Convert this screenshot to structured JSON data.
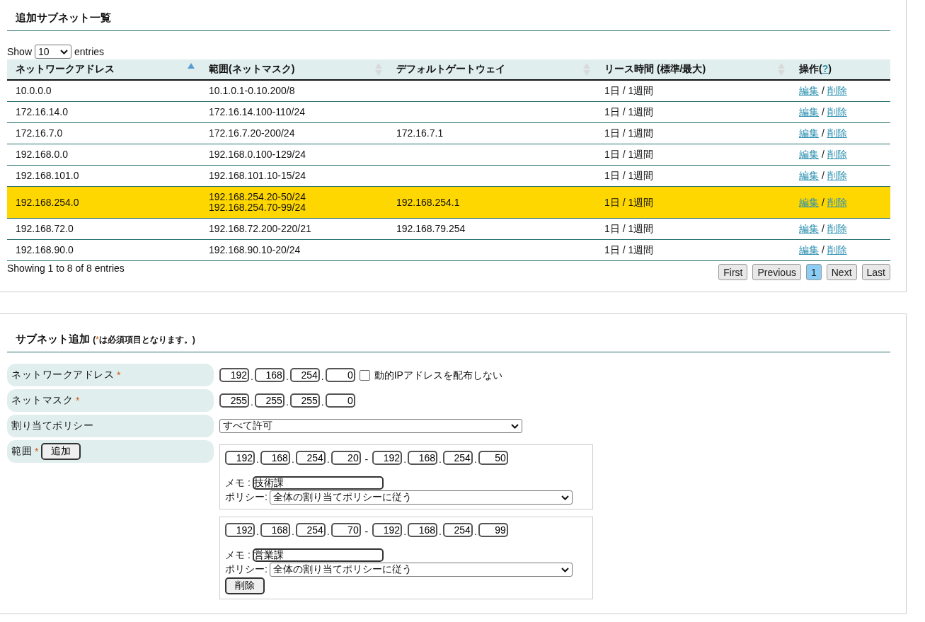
{
  "subnet_list": {
    "title": "追加サブネット一覧",
    "length": {
      "before": "Show",
      "value": "10",
      "after": "entries"
    },
    "columns": [
      {
        "label": "ネットワークアドレス",
        "sortable": true,
        "sorted": true
      },
      {
        "label": "範囲(ネットマスク)",
        "sortable": true,
        "sorted": false
      },
      {
        "label": "デフォルトゲートウェイ",
        "sortable": true,
        "sorted": false
      },
      {
        "label": "リース時間 (標準/最大)",
        "sortable": true,
        "sorted": false
      },
      {
        "label": "操作(",
        "help_link": "?",
        "after": ")",
        "sortable": false
      }
    ],
    "rows": [
      {
        "network": "10.0.0.0",
        "ranges": [
          "10.1.0.1-0.10.200/8"
        ],
        "gateway": "",
        "lease": "1日 / 1週間",
        "edit": "編集",
        "separator": "/",
        "delete": "削除",
        "selected": false
      },
      {
        "network": "172.16.14.0",
        "ranges": [
          "172.16.14.100-110/24"
        ],
        "gateway": "",
        "lease": "1日 / 1週間",
        "edit": "編集",
        "separator": "/",
        "delete": "削除",
        "selected": false
      },
      {
        "network": "172.16.7.0",
        "ranges": [
          "172.16.7.20-200/24"
        ],
        "gateway": "172.16.7.1",
        "lease": "1日 / 1週間",
        "edit": "編集",
        "separator": "/",
        "delete": "削除",
        "selected": false
      },
      {
        "network": "192.168.0.0",
        "ranges": [
          "192.168.0.100-129/24"
        ],
        "gateway": "",
        "lease": "1日 / 1週間",
        "edit": "編集",
        "separator": "/",
        "delete": "削除",
        "selected": false
      },
      {
        "network": "192.168.101.0",
        "ranges": [
          "192.168.101.10-15/24"
        ],
        "gateway": "",
        "lease": "1日 / 1週間",
        "edit": "編集",
        "separator": "/",
        "delete": "削除",
        "selected": false
      },
      {
        "network": "192.168.254.0",
        "ranges": [
          "192.168.254.20-50/24",
          "192.168.254.70-99/24"
        ],
        "gateway": "192.168.254.1",
        "lease": "1日 / 1週間",
        "edit": "編集",
        "separator": "/",
        "delete": "削除",
        "selected": true
      },
      {
        "network": "192.168.72.0",
        "ranges": [
          "192.168.72.200-220/21"
        ],
        "gateway": "192.168.79.254",
        "lease": "1日 / 1週間",
        "edit": "編集",
        "separator": "/",
        "delete": "削除",
        "selected": false
      },
      {
        "network": "192.168.90.0",
        "ranges": [
          "192.168.90.10-20/24"
        ],
        "gateway": "",
        "lease": "1日 / 1週間",
        "edit": "編集",
        "separator": "/",
        "delete": "削除",
        "selected": false
      }
    ],
    "info": "Showing 1 to 8 of 8 entries",
    "pagination": [
      {
        "label": "First",
        "selected": false
      },
      {
        "label": "Previous",
        "selected": false
      },
      {
        "label": "1",
        "selected": true
      },
      {
        "label": "Next",
        "selected": false
      },
      {
        "label": "Last",
        "selected": false
      }
    ]
  },
  "subnet_form": {
    "title": "サブネット追加",
    "octet_separator": ".",
    "note_open": "(",
    "note_mark": "*",
    "note_text": "は必須項目となります。)",
    "fields": [
      {
        "kind": "ip",
        "label": "ネットワークアドレス",
        "required_mark": "*",
        "octets": [
          "192",
          "168",
          "254",
          "0"
        ],
        "checkbox": {
          "label": "動的IPアドレスを配布しない",
          "checked": false
        }
      },
      {
        "kind": "ip",
        "label": "ネットマスク",
        "required_mark": "*",
        "octets": [
          "255",
          "255",
          "255",
          "0"
        ]
      },
      {
        "kind": "select",
        "label": "割り当てポリシー",
        "value": "すべて許可"
      },
      {
        "kind": "ranges",
        "label": "範囲",
        "required_mark": "*",
        "add_button": "追加",
        "ranges": [
          {
            "start": [
              "192",
              "168",
              "254",
              "20"
            ],
            "dash": "-",
            "end": [
              "192",
              "168",
              "254",
              "50"
            ],
            "memo_label": "メモ :",
            "memo": "技術課",
            "policy_label": "ポリシー:",
            "policy": "全体の割り当てポリシーに従う"
          },
          {
            "start": [
              "192",
              "168",
              "254",
              "70"
            ],
            "dash": "-",
            "end": [
              "192",
              "168",
              "254",
              "99"
            ],
            "memo_label": "メモ :",
            "memo": "営業課",
            "policy_label": "ポリシー:",
            "policy": "全体の割り当てポリシーに従う",
            "delete_button": "削除"
          }
        ]
      }
    ]
  }
}
